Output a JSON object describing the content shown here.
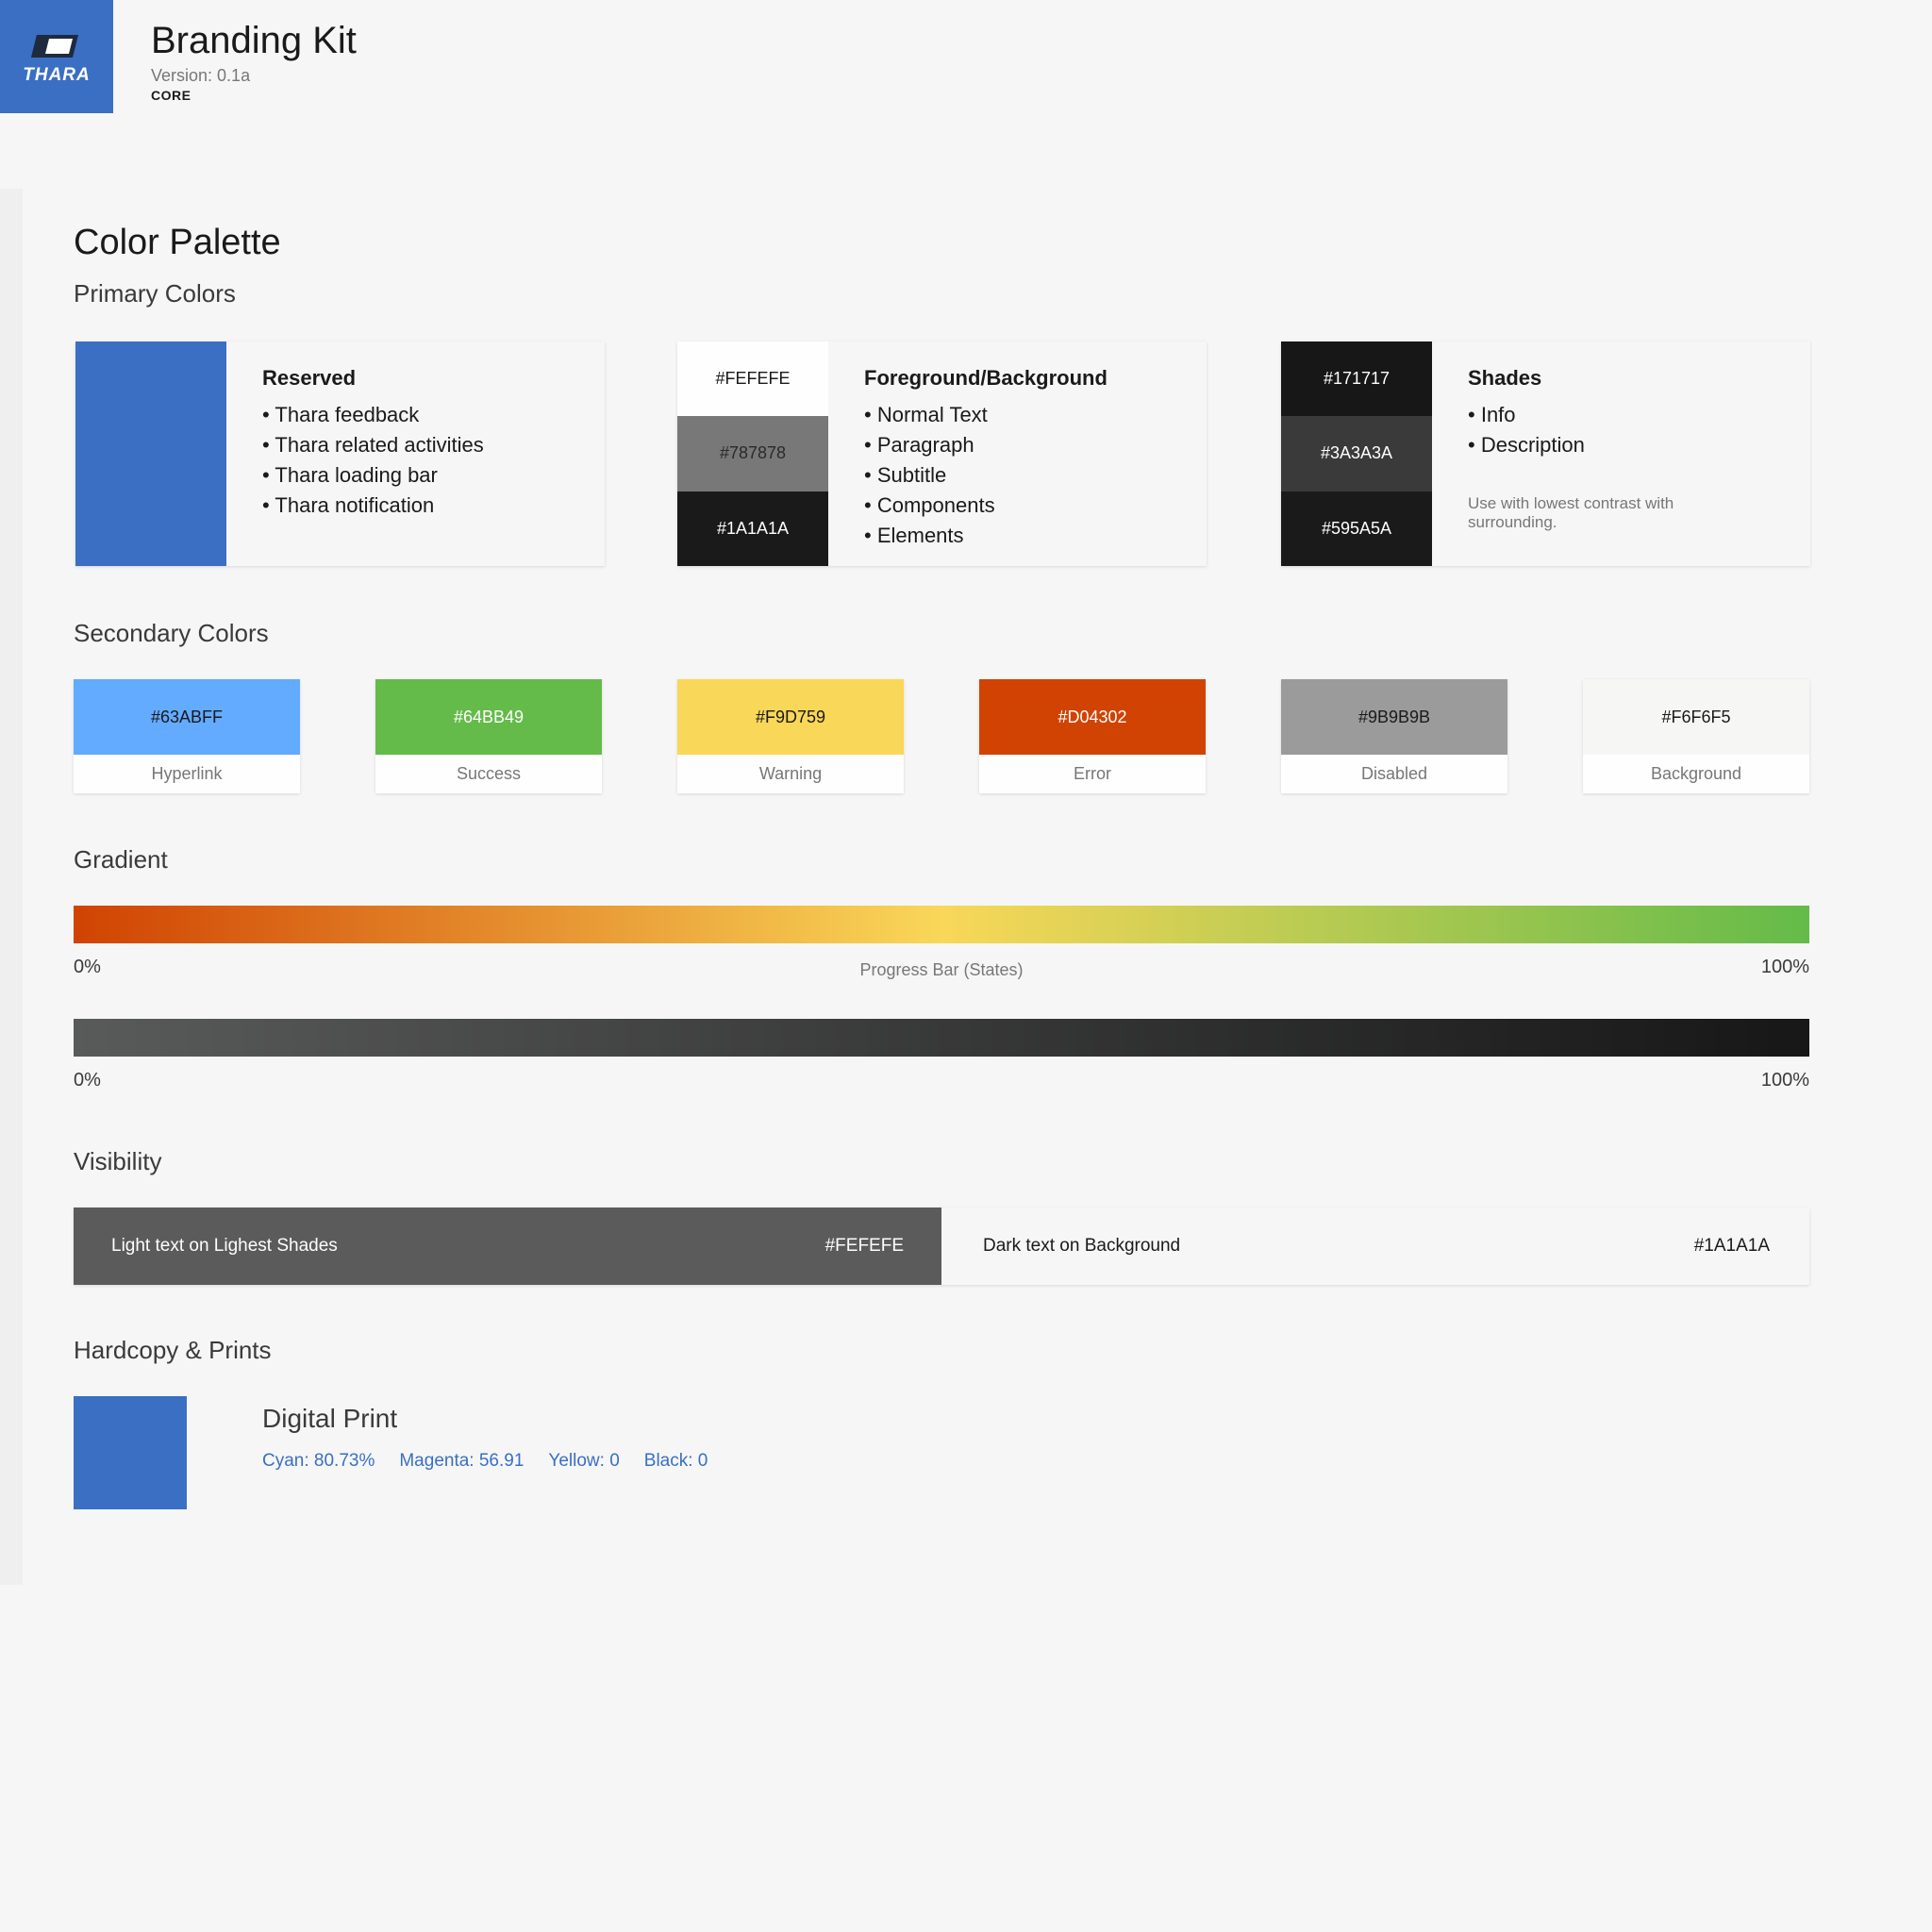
{
  "header": {
    "logo_text": "THARA",
    "title": "Branding Kit",
    "version": "Version: 0.1a",
    "tag": "CORE"
  },
  "palette": {
    "title": "Color Palette",
    "primary": {
      "heading": "Primary Colors",
      "reserved": {
        "color": "#3a6fc4",
        "title": "Reserved",
        "items": [
          "Thara feedback",
          "Thara related activities",
          "Thara loading bar",
          "Thara notification"
        ]
      },
      "foreground": {
        "swatches": [
          {
            "hex": "#FEFEFE",
            "bg": "#fefefe",
            "fg": "#1a1a1a"
          },
          {
            "hex": "#787878",
            "bg": "#787878",
            "fg": "#2a2a2a"
          },
          {
            "hex": "#1A1A1A",
            "bg": "#1a1a1a",
            "fg": "#fefefe"
          }
        ],
        "title": "Foreground/Background",
        "items": [
          "Normal Text",
          "Paragraph",
          "Subtitle",
          "Components",
          "Elements"
        ]
      },
      "shades": {
        "swatches": [
          {
            "hex": "#171717",
            "bg": "#171717",
            "fg": "#fefefe"
          },
          {
            "hex": "#3A3A3A",
            "bg": "#3a3a3a",
            "fg": "#fefefe"
          },
          {
            "hex": "#595A5A",
            "bg": "#1a1a1a",
            "fg": "#fefefe"
          }
        ],
        "title": "Shades",
        "items": [
          "Info",
          "Description"
        ],
        "note": "Use with lowest contrast with surrounding."
      }
    },
    "secondary": {
      "heading": "Secondary Colors",
      "tiles": [
        {
          "hex": "#63ABFF",
          "label": "Hyperlink",
          "bg": "#63abff",
          "fg": "#1a1a1a"
        },
        {
          "hex": "#64BB49",
          "label": "Success",
          "bg": "#64bb49",
          "fg": "#fefefe"
        },
        {
          "hex": "#F9D759",
          "label": "Warning",
          "bg": "#f9d759",
          "fg": "#1a1a1a"
        },
        {
          "hex": "#D04302",
          "label": "Error",
          "bg": "#d04302",
          "fg": "#fefefe"
        },
        {
          "hex": "#9B9B9B",
          "label": "Disabled",
          "bg": "#9b9b9b",
          "fg": "#1a1a1a"
        },
        {
          "hex": "#F6F6F5",
          "label": "Background",
          "bg": "#f6f6f5",
          "fg": "#1a1a1a"
        }
      ]
    },
    "gradient": {
      "heading": "Gradient",
      "progress": {
        "start": "0%",
        "end": "100%",
        "caption": "Progress Bar (States)",
        "colors": [
          "#d04302",
          "#f9d759",
          "#64bb49"
        ]
      },
      "dark": {
        "start": "0%",
        "end": "100%",
        "colors": [
          "#595a5a",
          "#171717"
        ]
      }
    },
    "visibility": {
      "heading": "Visibility",
      "light_text": "Light text on Lighest Shades",
      "light_hex": "#FEFEFE",
      "dark_text": "Dark text on Background",
      "dark_hex": "#1A1A1A"
    },
    "print": {
      "heading": "Hardcopy & Prints",
      "color": "#3a6fc4",
      "title": "Digital Print",
      "values": [
        "Cyan: 80.73%",
        "Magenta: 56.91",
        "Yellow: 0",
        "Black: 0"
      ]
    }
  }
}
